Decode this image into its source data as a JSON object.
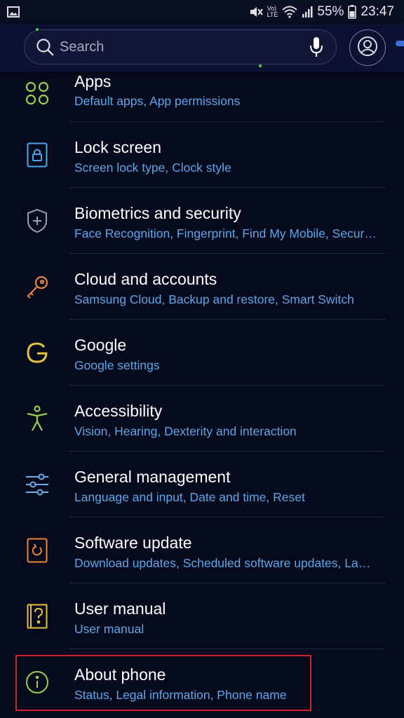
{
  "status_bar": {
    "signal_label": "VoLTE",
    "battery_percent": "55%",
    "time": "23:47"
  },
  "search": {
    "placeholder": "Search"
  },
  "settings_items": [
    {
      "title": "Apps",
      "subtitle": "Default apps, App permissions",
      "icon": "apps-grid-icon",
      "icon_color": "#9ad14a"
    },
    {
      "title": "Lock screen",
      "subtitle": "Screen lock type, Clock style",
      "icon": "lock-icon",
      "icon_color": "#4aa8e8"
    },
    {
      "title": "Biometrics and security",
      "subtitle": "Face Recognition, Fingerprint, Find My Mobile, Secur…",
      "icon": "shield-icon",
      "icon_color": "#9aa0b4"
    },
    {
      "title": "Cloud and accounts",
      "subtitle": "Samsung Cloud, Backup and restore, Smart Switch",
      "icon": "key-icon",
      "icon_color": "#e8873a"
    },
    {
      "title": "Google",
      "subtitle": "Google settings",
      "icon": "google-icon",
      "icon_color": "#e8c23a"
    },
    {
      "title": "Accessibility",
      "subtitle": "Vision, Hearing, Dexterity and interaction",
      "icon": "accessibility-icon",
      "icon_color": "#9ad14a"
    },
    {
      "title": "General management",
      "subtitle": "Language and input, Date and time, Reset",
      "icon": "sliders-icon",
      "icon_color": "#6ab0e8"
    },
    {
      "title": "Software update",
      "subtitle": "Download updates, Scheduled software updates, La…",
      "icon": "software-update-icon",
      "icon_color": "#e8873a"
    },
    {
      "title": "User manual",
      "subtitle": "User manual",
      "icon": "user-manual-icon",
      "icon_color": "#e8c23a"
    },
    {
      "title": "About phone",
      "subtitle": "Status, Legal information, Phone name",
      "icon": "info-icon",
      "icon_color": "#9ad14a"
    }
  ],
  "colors": {
    "background": "#060a1d",
    "subtitle": "#5fa6e6",
    "highlight_border": "#d4232e"
  }
}
